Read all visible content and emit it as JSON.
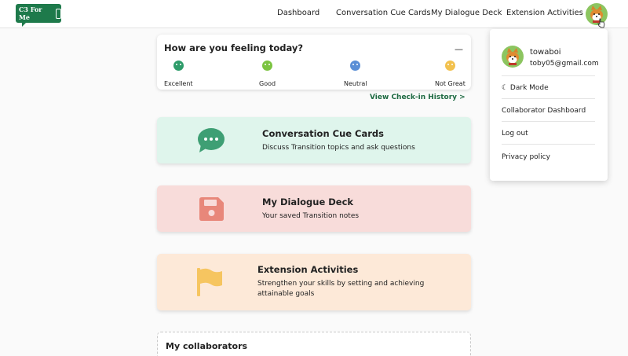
{
  "nav": {
    "logo_text": "C3 For Me",
    "links": [
      "Dashboard",
      "Conversation Cue Cards",
      "My Dialogue Deck",
      "Extension Activities"
    ]
  },
  "mood": {
    "title": "How are you feeling today?",
    "minimize": "—",
    "options": [
      {
        "label": "Excellent",
        "color": "#2e9c6a"
      },
      {
        "label": "Good",
        "color": "#7cc442"
      },
      {
        "label": "Neutral",
        "color": "#5b8fd6"
      },
      {
        "label": "Not Great",
        "color": "#f2c14e"
      }
    ],
    "history_link": "View Check-in History  >"
  },
  "features": [
    {
      "title": "Conversation Cue Cards",
      "desc": "Discuss Transition topics and ask questions",
      "bg": "#dff5ec",
      "icon": "chat-bubble-icon",
      "icon_color": "#3e9f74"
    },
    {
      "title": "My Dialogue Deck",
      "desc": "Your saved Transition notes",
      "bg": "#f8dcda",
      "icon": "save-icon",
      "icon_color": "#e8877a"
    },
    {
      "title": "Extension Activities",
      "desc": "Strengthen your skills by setting and achieving attainable goals",
      "bg": "#fde9d8",
      "icon": "flag-icon",
      "icon_color": "#f6c560"
    }
  ],
  "collaborators": {
    "title": "My collaborators"
  },
  "user_menu": {
    "name": "towaboi",
    "email": "toby05@gmail.com",
    "items": [
      "☾ Dark Mode",
      "Collaborator Dashboard",
      "Log out",
      "Privacy policy"
    ]
  }
}
